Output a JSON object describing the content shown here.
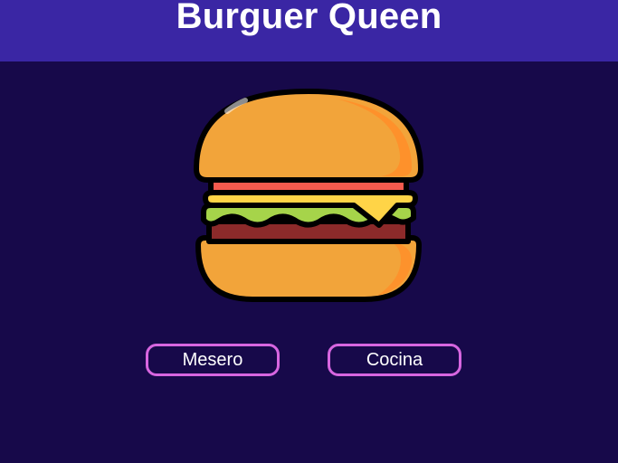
{
  "header": {
    "title": "Burguer Queen"
  },
  "hero": {
    "icon": "hamburger-icon"
  },
  "buttons": {
    "mesero_label": "Mesero",
    "cocina_label": "Cocina"
  },
  "colors": {
    "background": "#17094a",
    "header_background": "#3a26a4",
    "button_border": "#d766e0",
    "text": "#ffffff"
  }
}
